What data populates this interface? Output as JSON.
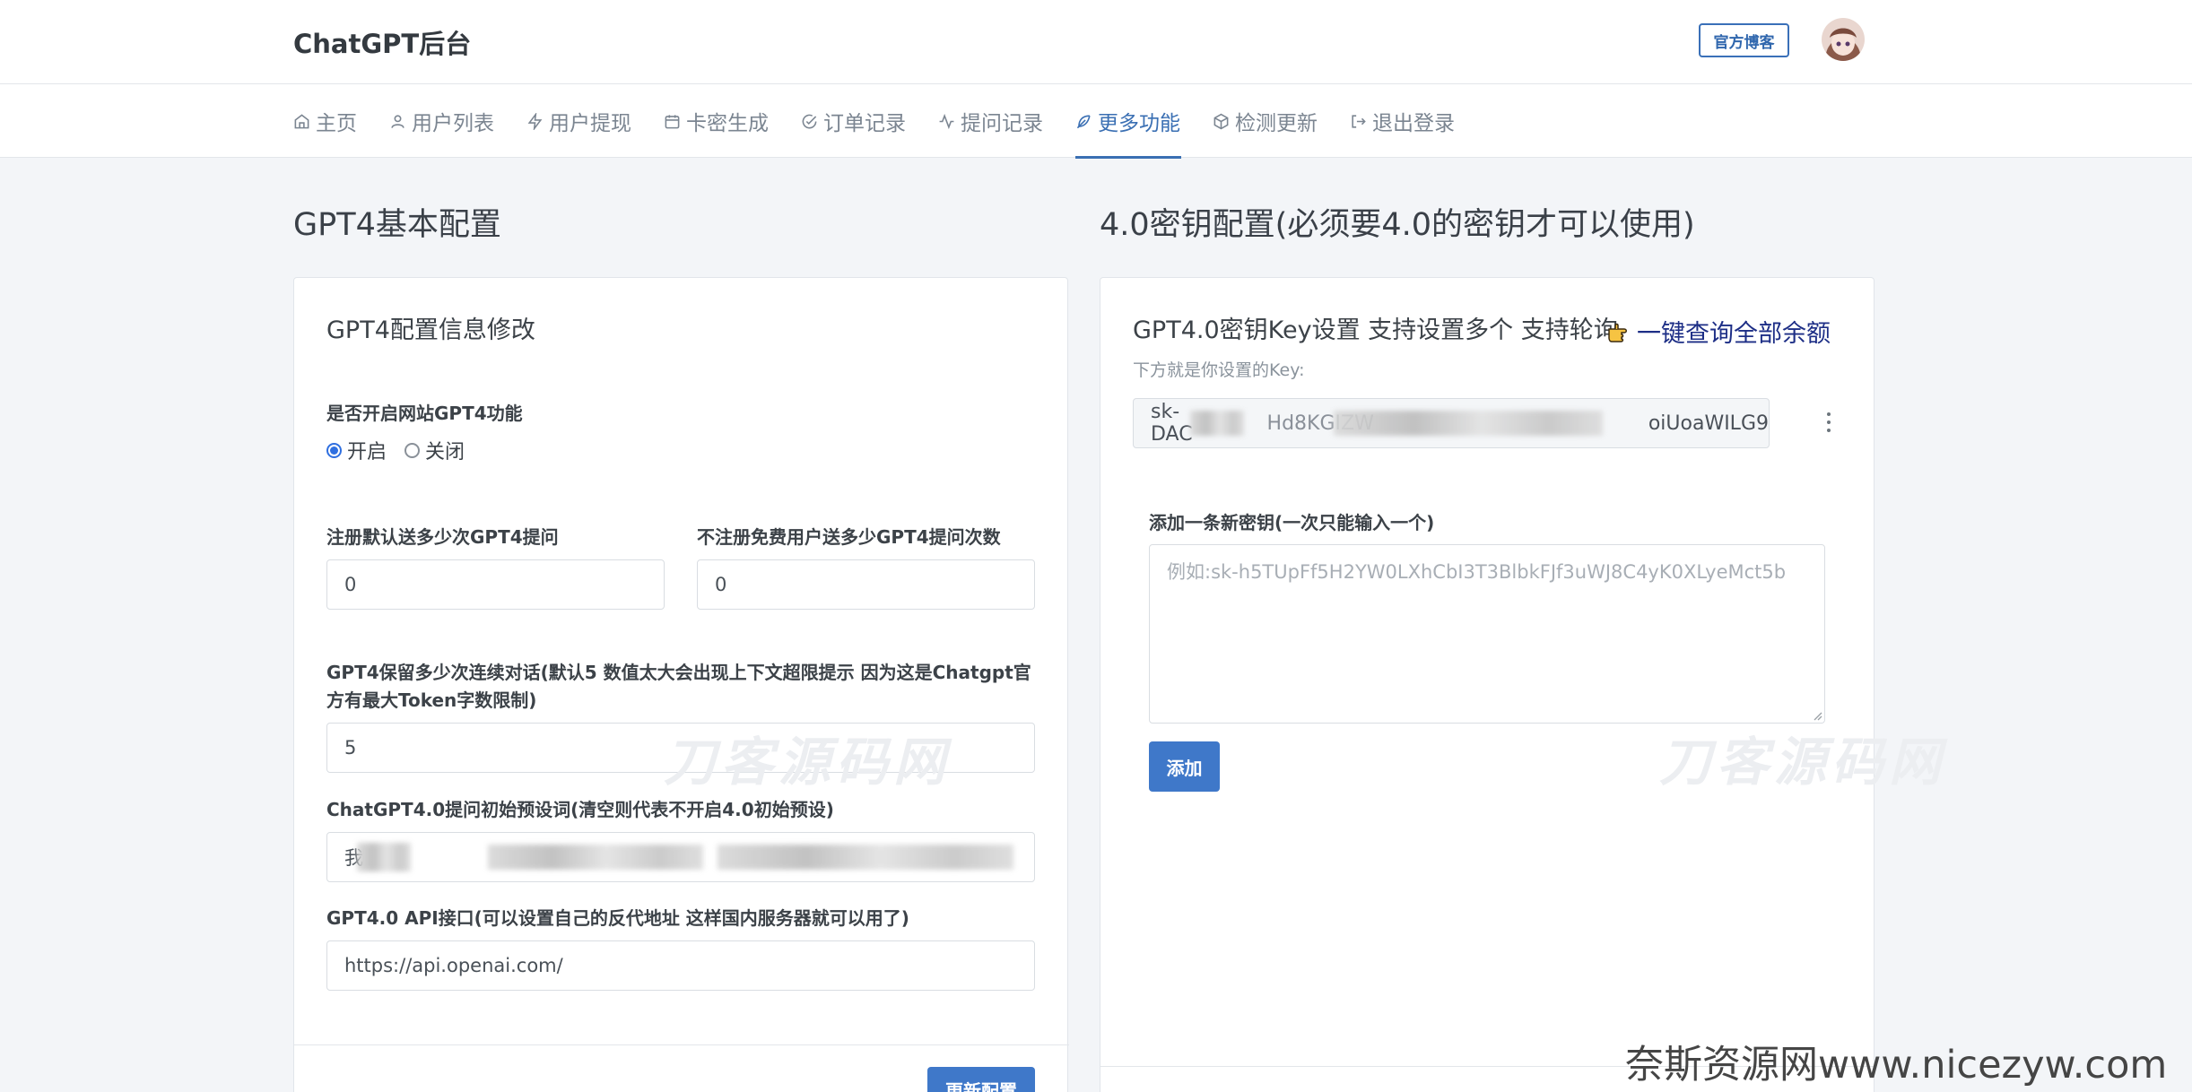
{
  "header": {
    "brand": "ChatGPT后台",
    "blog_button": "官方博客"
  },
  "nav": [
    {
      "label": "主页",
      "icon": "home-icon",
      "active": false
    },
    {
      "label": "用户列表",
      "icon": "user-icon",
      "active": false
    },
    {
      "label": "用户提现",
      "icon": "lightning-icon",
      "active": false
    },
    {
      "label": "卡密生成",
      "icon": "calendar-icon",
      "active": false
    },
    {
      "label": "订单记录",
      "icon": "check-circle-icon",
      "active": false
    },
    {
      "label": "提问记录",
      "icon": "activity-icon",
      "active": false
    },
    {
      "label": "更多功能",
      "icon": "feather-icon",
      "active": true
    },
    {
      "label": "检测更新",
      "icon": "box-icon",
      "active": false
    },
    {
      "label": "退出登录",
      "icon": "logout-icon",
      "active": false
    }
  ],
  "left": {
    "section_title": "GPT4基本配置",
    "card_title": "GPT4配置信息修改",
    "enable_label": "是否开启网站GPT4功能",
    "radio_on": "开启",
    "radio_off": "关闭",
    "register_label": "注册默认送多少次GPT4提问",
    "register_value": "0",
    "free_label": "不注册免费用户送多少GPT4提问次数",
    "free_value": "0",
    "context_label_line1": "GPT4保留多少次连续对话(默认5 数值太大会出现上下文超限提示 因为这是Chatgpt官",
    "context_label_line2": "方有最大Token字数限制)",
    "context_value": "5",
    "preset_label": "ChatGPT4.0提问初始预设词(清空则代表不开启4.0初始预设)",
    "preset_value_start": "我",
    "api_label": "GPT4.0 API接口(可以设置自己的反代地址 这样国内服务器就可以用了)",
    "api_value": "https://api.openai.com/",
    "update_button": "更新配置"
  },
  "right": {
    "section_title": "4.0密钥配置(必须要4.0的密钥才可以使用)",
    "card_title": "GPT4.0密钥Key设置 支持设置多个 支持轮询",
    "query_link": "一键查询全部余额",
    "key_hint": "下方就是你设置的Key:",
    "key_prefix": "sk-DAC",
    "key_mid": "Hd8KGIZW",
    "key_suffix": "oiUoaWILG9",
    "add_label": "添加一条新密钥(一次只能输入一个)",
    "add_placeholder": "例如: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",
    "add_button": "添加"
  },
  "watermarks": [
    "刀客源码网",
    "刀客源码网"
  ],
  "site_mark": "奈斯资源网www.nicezyw.com",
  "colors": {
    "accent": "#3a6fb3",
    "button": "#3f78c9",
    "background": "#f3f5f8"
  }
}
